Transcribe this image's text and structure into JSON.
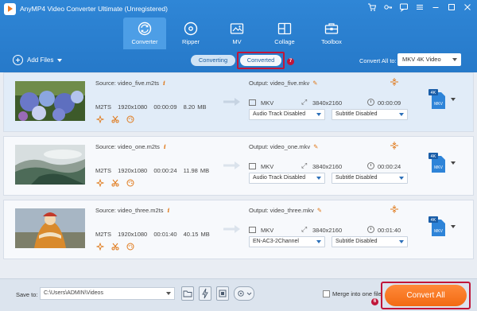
{
  "app": {
    "title": "AnyMP4 Video Converter Ultimate (Unregistered)"
  },
  "main_tabs": [
    {
      "label": "Converter",
      "icon": "converter-icon",
      "active": true
    },
    {
      "label": "Ripper",
      "icon": "disc-icon",
      "active": false
    },
    {
      "label": "MV",
      "icon": "mv-icon",
      "active": false
    },
    {
      "label": "Collage",
      "icon": "collage-icon",
      "active": false
    },
    {
      "label": "Toolbox",
      "icon": "toolbox-icon",
      "active": false
    }
  ],
  "subbar": {
    "add_files": "Add Files",
    "segments": {
      "converting": "Converting",
      "converted": "Converted"
    },
    "converted_badge": "7",
    "convert_all_to": "Convert All to:",
    "format": "MKV 4K Video"
  },
  "files": [
    {
      "source": "Source: video_five.m2ts",
      "container": "M2TS",
      "resolution": "1920x1080",
      "duration": "00:00:09",
      "size": "8.20 MB",
      "output": "Output: video_five.mkv",
      "out_format": "MKV",
      "out_resolution": "3840x2160",
      "out_duration": "00:00:09",
      "audio": "Audio Track Disabled",
      "subtitle": "Subtitle Disabled",
      "badge_top": "4K",
      "badge_label": "MKV"
    },
    {
      "source": "Source: video_one.m2ts",
      "container": "M2TS",
      "resolution": "1920x1080",
      "duration": "00:00:24",
      "size": "11.98 MB",
      "output": "Output: video_one.mkv",
      "out_format": "MKV",
      "out_resolution": "3840x2160",
      "out_duration": "00:00:24",
      "audio": "Audio Track Disabled",
      "subtitle": "Subtitle Disabled",
      "badge_top": "4K",
      "badge_label": "MKV"
    },
    {
      "source": "Source: video_three.m2ts",
      "container": "M2TS",
      "resolution": "1920x1080",
      "duration": "00:01:40",
      "size": "40.15 MB",
      "output": "Output: video_three.mkv",
      "out_format": "MKV",
      "out_resolution": "3840x2160",
      "out_duration": "00:01:40",
      "audio": "EN-AC3-2Channel",
      "subtitle": "Subtitle Disabled",
      "badge_top": "4K",
      "badge_label": "MKV"
    }
  ],
  "bottom": {
    "save_to_label": "Save to:",
    "save_path": "C:\\Users\\ADMIN\\Videos",
    "merge_label": "Merge into one file",
    "convert_all": "Convert All",
    "convert_badge": "6"
  },
  "colors": {
    "brand_blue": "#2679c9",
    "accent_orange": "#f26a12",
    "highlight_red": "#c0163a"
  }
}
